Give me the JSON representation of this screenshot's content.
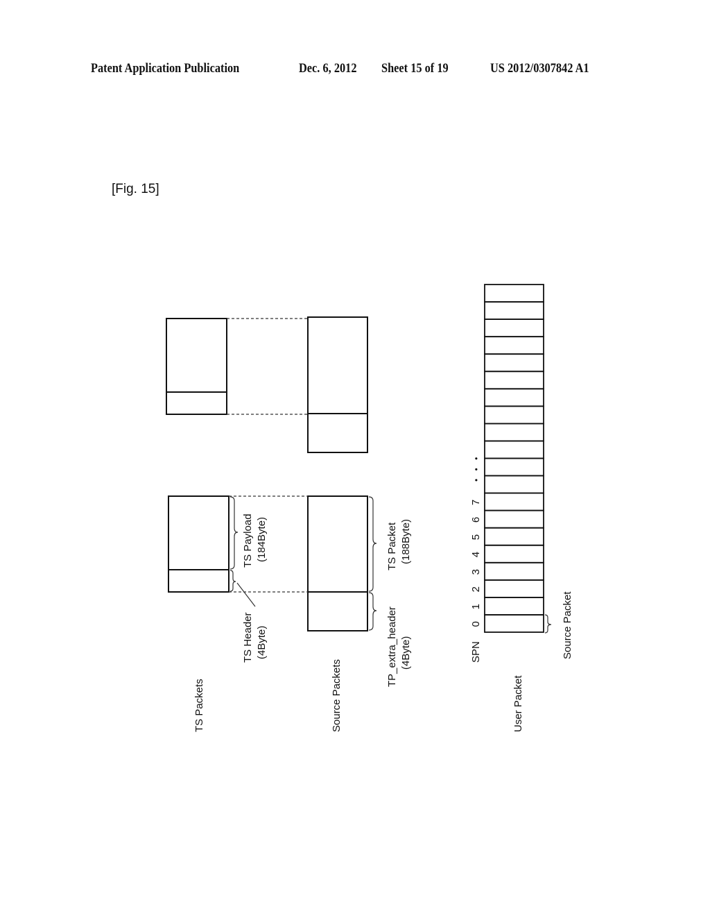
{
  "header": {
    "publication": "Patent Application Publication",
    "date": "Dec. 6, 2012",
    "sheet": "Sheet 15 of 19",
    "number": "US 2012/0307842 A1"
  },
  "figure": {
    "label": "[Fig. 15]"
  },
  "labels": {
    "ts_packets": "TS Packets",
    "source_packets": "Source Packets",
    "user_packet": "User Packet",
    "ts_header": "TS Header",
    "ts_header_size": "(4Byte)",
    "ts_payload": "TS Payload",
    "ts_payload_size": "(184Byte)",
    "tp_extra_header": "TP_extra_header",
    "tp_extra_header_size": "(4Byte)",
    "ts_packet": "TS Packet",
    "ts_packet_size": "(188Byte)",
    "source_packet": "Source Packet",
    "spn": "SPN",
    "ellipsis": "• • •"
  },
  "spn_numbers": [
    "0",
    "1",
    "2",
    "3",
    "4",
    "5",
    "6",
    "7"
  ],
  "user_packet_slot_count": 20
}
